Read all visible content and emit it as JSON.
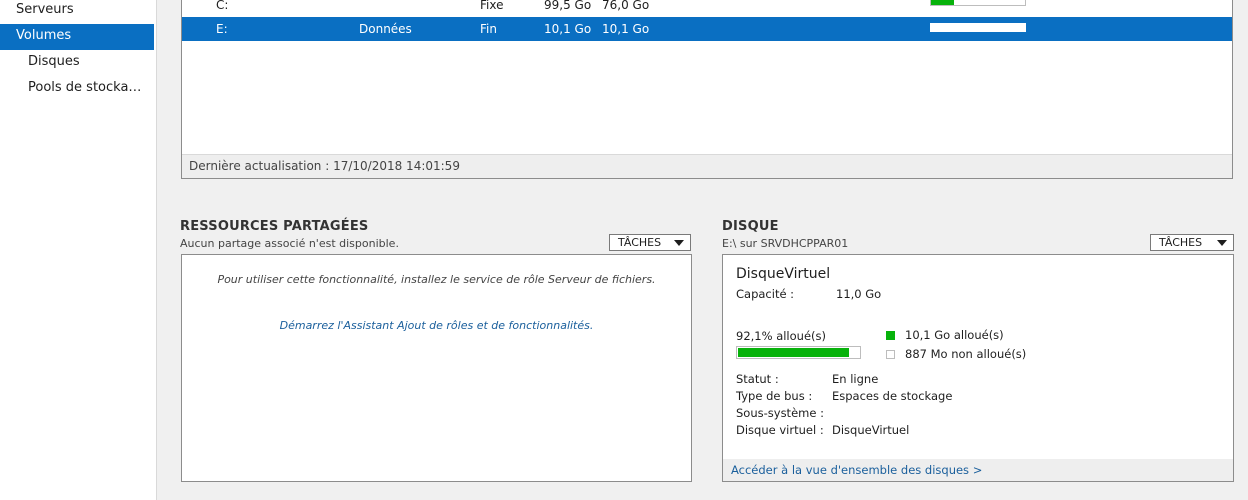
{
  "sidebar": {
    "items": [
      {
        "label": "Serveurs"
      },
      {
        "label": "Volumes"
      },
      {
        "label": "Disques"
      },
      {
        "label": "Pools de stocka…"
      }
    ]
  },
  "volumes": {
    "rows": [
      {
        "drive": "C:",
        "label": "",
        "provisioning": "Fixe",
        "capacity": "99,5 Go",
        "free": "76,0 Go",
        "used_fraction": 0.24
      },
      {
        "drive": "E:",
        "label": "Données",
        "provisioning": "Fin",
        "capacity": "10,1 Go",
        "free": "10,1 Go",
        "used_fraction": 0.0
      }
    ],
    "footer": "Dernière actualisation : 17/10/2018 14:01:59"
  },
  "shares": {
    "title": "RESSOURCES PARTAGÉES",
    "subtitle": "Aucun partage associé n'est disponible.",
    "tasks_label": "TÂCHES",
    "message": "Pour utiliser cette fonctionnalité, installez le service de rôle Serveur de fichiers.",
    "link": "Démarrez l'Assistant Ajout de rôles et de fonctionnalités."
  },
  "disk": {
    "title": "DISQUE",
    "subtitle": "E:\\ sur SRVDHCPPAR01",
    "tasks_label": "TÂCHES",
    "name": "DisqueVirtuel",
    "capacity_label": "Capacité :",
    "capacity_value": "11,0 Go",
    "allocated_pct_label": "92,1% alloué(s)",
    "allocated_fraction": 0.921,
    "legend_allocated": "10,1 Go alloué(s)",
    "legend_unallocated": "887 Mo non alloué(s)",
    "allocated_color": "#07b20b",
    "details": [
      {
        "label": "Statut :",
        "value": "En ligne"
      },
      {
        "label": "Type de bus :",
        "value": "Espaces de stockage"
      },
      {
        "label": "Sous-système :",
        "value": ""
      },
      {
        "label": "Disque virtuel :",
        "value": "DisqueVirtuel"
      }
    ],
    "footer_link": "Accéder à la vue d'ensemble des disques >"
  },
  "colors": {
    "selection": "#0a6fc2",
    "link": "#1a5f9c",
    "usage_bar": "#07b20b"
  }
}
